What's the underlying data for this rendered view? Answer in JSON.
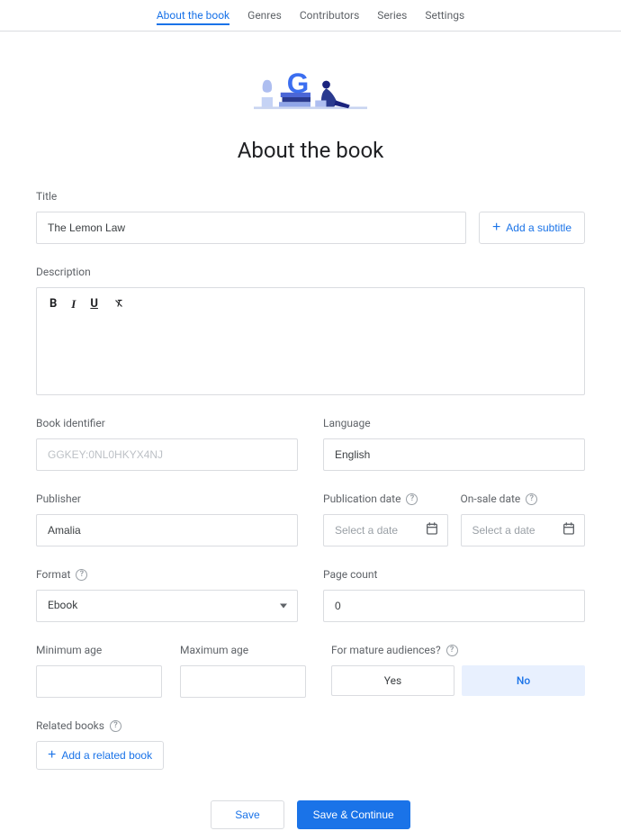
{
  "tabs": {
    "about": "About the book",
    "genres": "Genres",
    "contributors": "Contributors",
    "series": "Series",
    "settings": "Settings"
  },
  "page_title": "About the book",
  "labels": {
    "title": "Title",
    "description": "Description",
    "book_identifier": "Book identifier",
    "language": "Language",
    "publisher": "Publisher",
    "publication_date": "Publication date",
    "on_sale_date": "On-sale date",
    "format": "Format",
    "page_count": "Page count",
    "minimum_age": "Minimum age",
    "maximum_age": "Maximum age",
    "mature": "For mature audiences?",
    "related_books": "Related books"
  },
  "values": {
    "title": "The Lemon Law",
    "book_identifier": "GGKEY:0NL0HKYX4NJ",
    "language": "English",
    "publisher": "Amalia",
    "format": "Ebook",
    "page_count": "0",
    "minimum_age": "",
    "maximum_age": ""
  },
  "placeholders": {
    "select_date": "Select a date"
  },
  "buttons": {
    "add_subtitle": "Add a subtitle",
    "add_related": "Add a related book",
    "yes": "Yes",
    "no": "No",
    "save": "Save",
    "save_continue": "Save & Continue"
  },
  "mature_selected": "No"
}
